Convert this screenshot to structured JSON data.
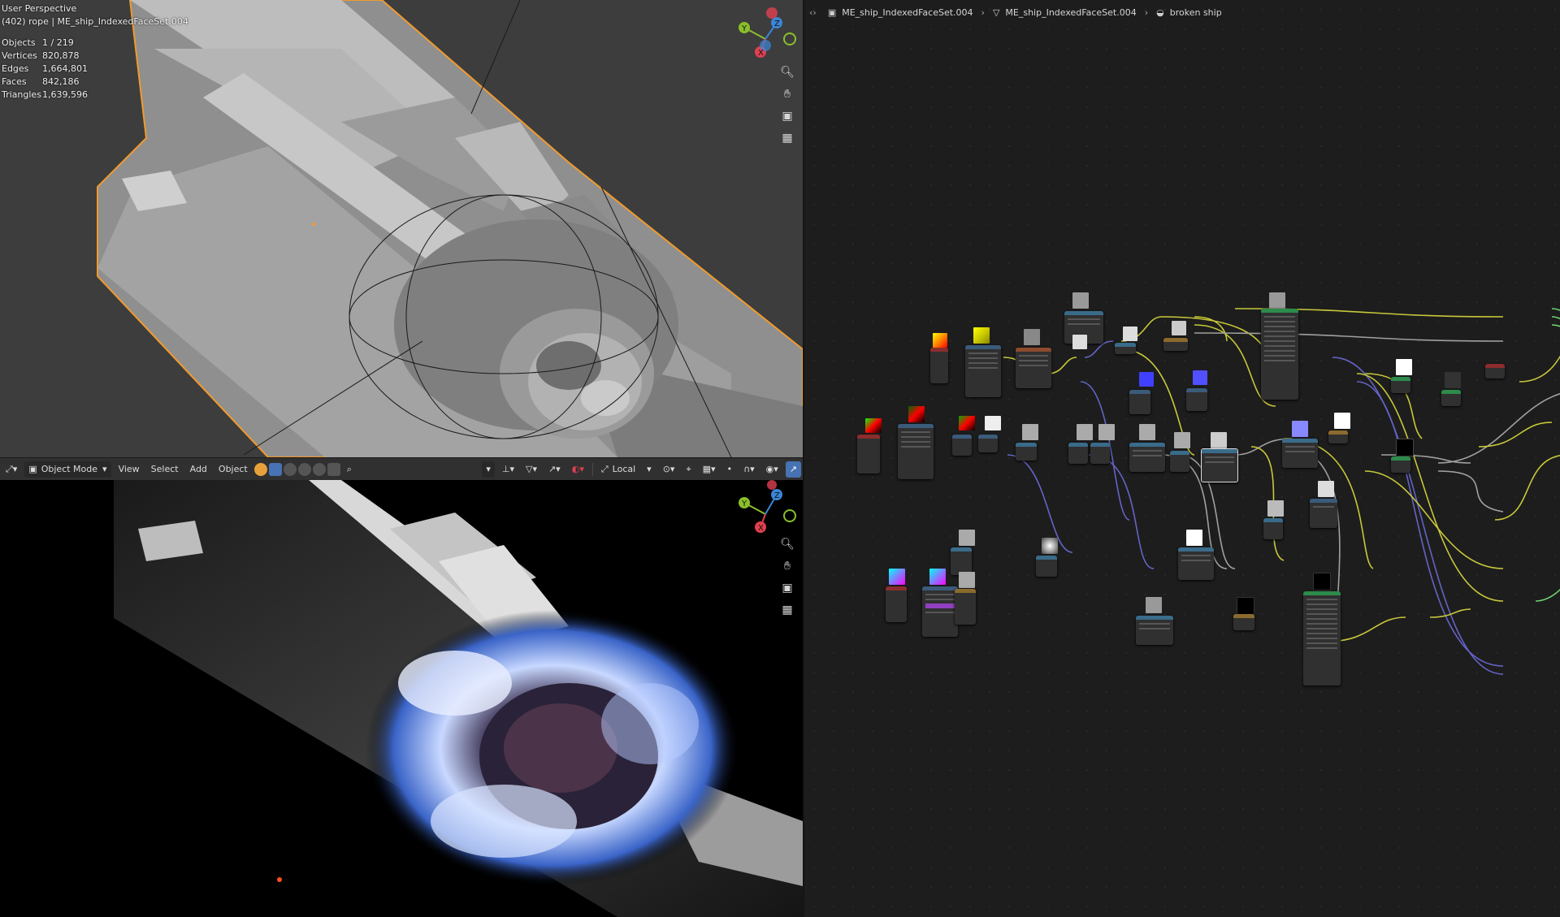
{
  "top_viewport": {
    "view_name": "User Perspective",
    "object_line": "(402) rope | ME_ship_IndexedFaceSet.004",
    "stats": [
      {
        "label": "Objects",
        "value": "1 / 219"
      },
      {
        "label": "Vertices",
        "value": "820,878"
      },
      {
        "label": "Edges",
        "value": "1,664,801"
      },
      {
        "label": "Faces",
        "value": "842,186"
      },
      {
        "label": "Triangles",
        "value": "1,639,596"
      }
    ],
    "gizmo_axes": [
      "Y",
      "Z",
      "X"
    ]
  },
  "viewport_header": {
    "editor_icon": "editor-type-icon",
    "mode": "Object Mode",
    "menus": [
      "View",
      "Select",
      "Add",
      "Object"
    ],
    "transform_orientation": "Local"
  },
  "node_editor": {
    "breadcrumbs": [
      {
        "icon": "mesh-object-icon",
        "label": "ME_ship_IndexedFaceSet.004"
      },
      {
        "icon": "mesh-data-icon",
        "label": "ME_ship_IndexedFaceSet.004"
      },
      {
        "icon": "material-icon",
        "label": "broken ship"
      }
    ]
  },
  "colors": {
    "selection_outline": "#f29a2e",
    "axis_x": "#e04050",
    "axis_y": "#8bbf2a",
    "axis_z": "#3a86d8",
    "header_active": "#4772b3",
    "link_color": "#c8c83a",
    "link_shader": "#6fd36f",
    "link_vector": "#6464c8",
    "link_float": "#a0a0a0"
  }
}
